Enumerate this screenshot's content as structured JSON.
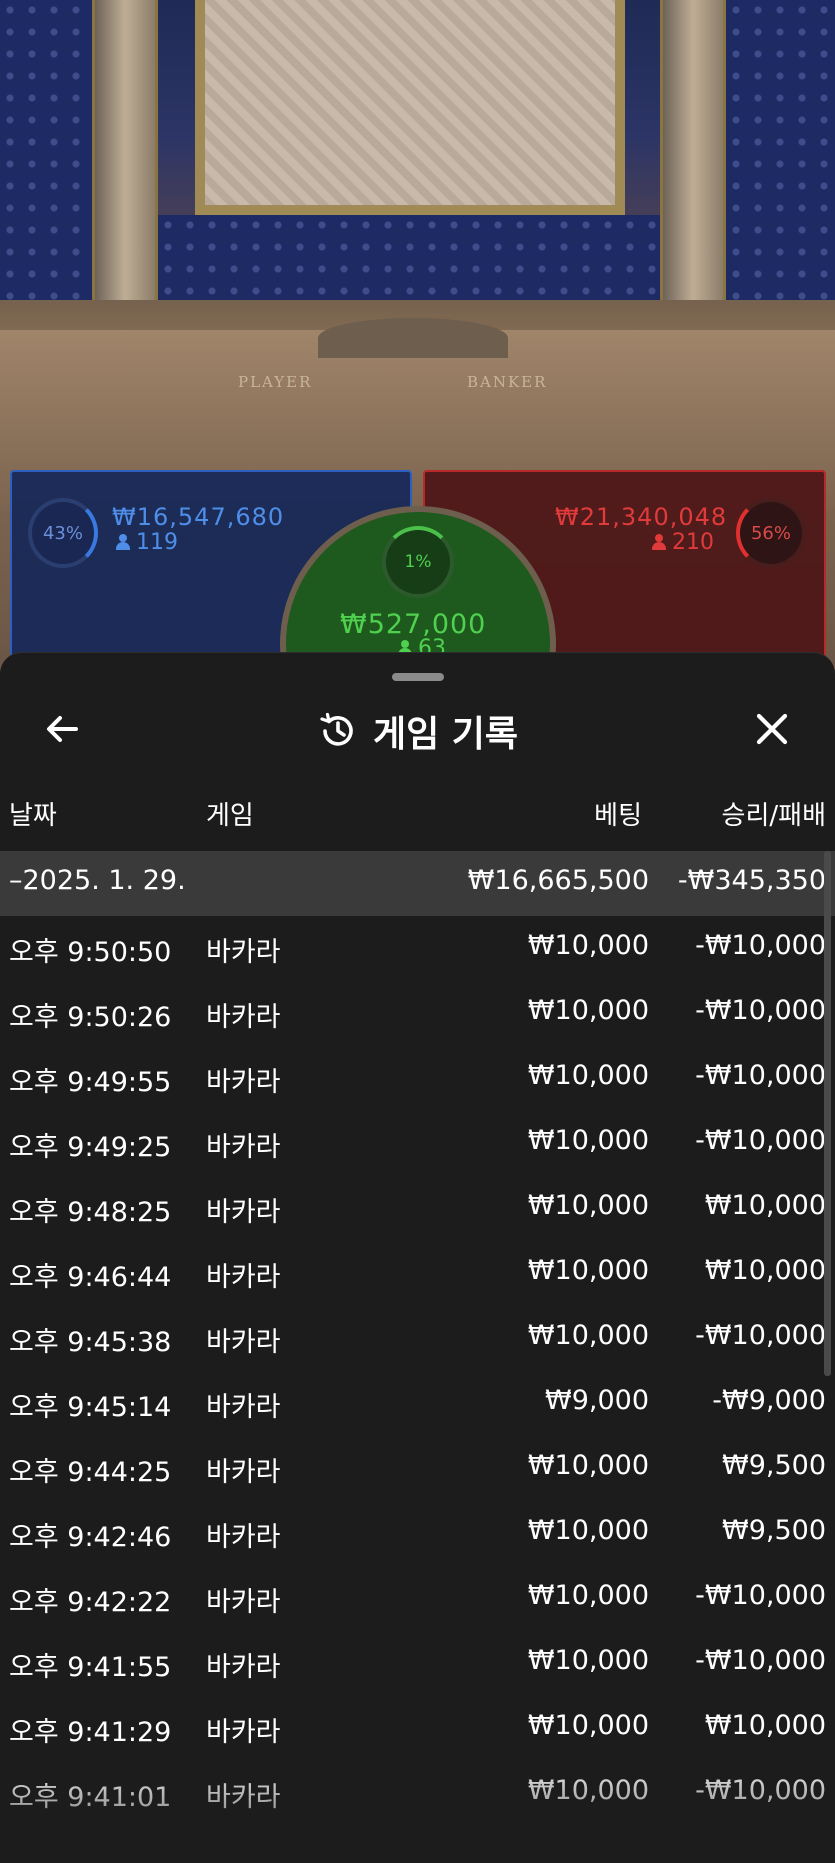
{
  "game_view": {
    "table_labels": {
      "player": "PLAYER",
      "banker": "BANKER"
    },
    "player": {
      "percent": "43%",
      "amount": "₩16,547,680",
      "count": "119",
      "color": "#3a79e0"
    },
    "tie": {
      "percent": "1%",
      "amount": "₩527,000",
      "count": "63",
      "color": "#4fd04f"
    },
    "banker": {
      "percent": "56%",
      "amount": "₩21,340,048",
      "count": "210",
      "color": "#e03030"
    }
  },
  "sheet": {
    "title": "게임 기록",
    "title_icon": "history-icon",
    "back_icon": "arrow-left-icon",
    "close_icon": "close-icon",
    "columns": {
      "date": "날짜",
      "game": "게임",
      "bet": "베팅",
      "result": "승리/패배"
    },
    "date_group": {
      "date": "–2025. 1. 29.",
      "bet": "₩16,665,500",
      "result": "-₩345,350"
    },
    "rows": [
      {
        "time": "오후 9:50:50",
        "game": "바카라",
        "bet": "₩10,000",
        "result": "-₩10,000"
      },
      {
        "time": "오후 9:50:26",
        "game": "바카라",
        "bet": "₩10,000",
        "result": "-₩10,000"
      },
      {
        "time": "오후 9:49:55",
        "game": "바카라",
        "bet": "₩10,000",
        "result": "-₩10,000"
      },
      {
        "time": "오후 9:49:25",
        "game": "바카라",
        "bet": "₩10,000",
        "result": "-₩10,000"
      },
      {
        "time": "오후 9:48:25",
        "game": "바카라",
        "bet": "₩10,000",
        "result": "₩10,000"
      },
      {
        "time": "오후 9:46:44",
        "game": "바카라",
        "bet": "₩10,000",
        "result": "₩10,000"
      },
      {
        "time": "오후 9:45:38",
        "game": "바카라",
        "bet": "₩10,000",
        "result": "-₩10,000"
      },
      {
        "time": "오후 9:45:14",
        "game": "바카라",
        "bet": "₩9,000",
        "result": "-₩9,000"
      },
      {
        "time": "오후 9:44:25",
        "game": "바카라",
        "bet": "₩10,000",
        "result": "₩9,500"
      },
      {
        "time": "오후 9:42:46",
        "game": "바카라",
        "bet": "₩10,000",
        "result": "₩9,500"
      },
      {
        "time": "오후 9:42:22",
        "game": "바카라",
        "bet": "₩10,000",
        "result": "-₩10,000"
      },
      {
        "time": "오후 9:41:55",
        "game": "바카라",
        "bet": "₩10,000",
        "result": "-₩10,000"
      },
      {
        "time": "오후 9:41:29",
        "game": "바카라",
        "bet": "₩10,000",
        "result": "₩10,000"
      },
      {
        "time": "오후 9:41:01",
        "game": "바카라",
        "bet": "₩10,000",
        "result": "-₩10,000"
      }
    ]
  }
}
